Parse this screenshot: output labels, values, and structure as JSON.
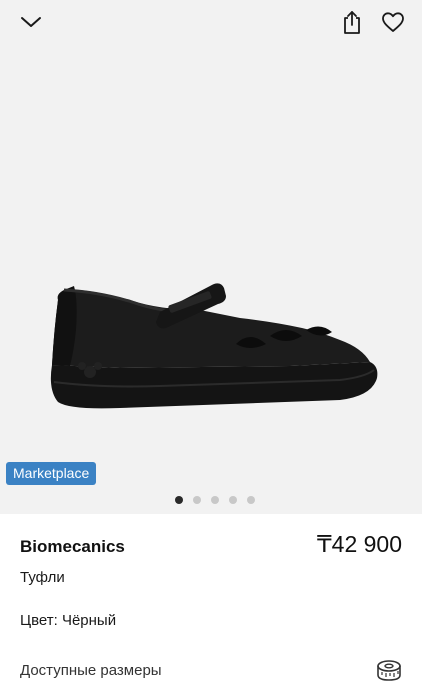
{
  "icons": {
    "back": "chevron-down-icon",
    "share": "share-icon",
    "favorite": "heart-icon",
    "size_guide": "measuring-tape-icon"
  },
  "gallery": {
    "badge": "Marketplace",
    "badge_color": "#3b82c4",
    "image_count": 5,
    "active_index": 0,
    "background": "#f2f2f2"
  },
  "product": {
    "brand": "Biomecanics",
    "price": "₸42 900",
    "category": "Туфли",
    "color_label": "Цвет: Чёрный",
    "sizes_label": "Доступные размеры"
  }
}
